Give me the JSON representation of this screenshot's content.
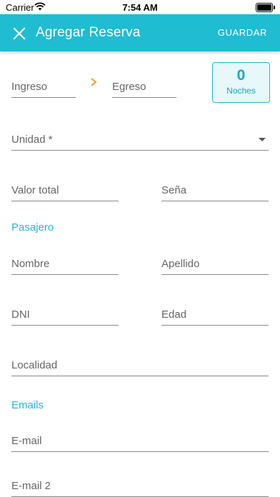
{
  "status": {
    "carrier": "Carrier",
    "time": "7:54 AM"
  },
  "appbar": {
    "title": "Agregar Reserva",
    "save": "GUARDAR"
  },
  "dates": {
    "checkin": "Ingreso",
    "checkout": "Egreso"
  },
  "nights": {
    "count": "0",
    "label": "Noches"
  },
  "unit": {
    "label": "Unidad *"
  },
  "payment": {
    "total": "Valor total",
    "deposit": "Seña"
  },
  "guest": {
    "section": "Pasajero",
    "first_name": "Nombre",
    "last_name": "Apellido",
    "dni": "DNI",
    "age": "Edad",
    "city": "Localidad"
  },
  "emails": {
    "section": "Emails",
    "email1": "E-mail",
    "email2": "E-mail 2"
  },
  "colors": {
    "primary": "#1fbcd2",
    "nights_bg": "#e7f7fa",
    "arrow": "#f39a3a"
  }
}
